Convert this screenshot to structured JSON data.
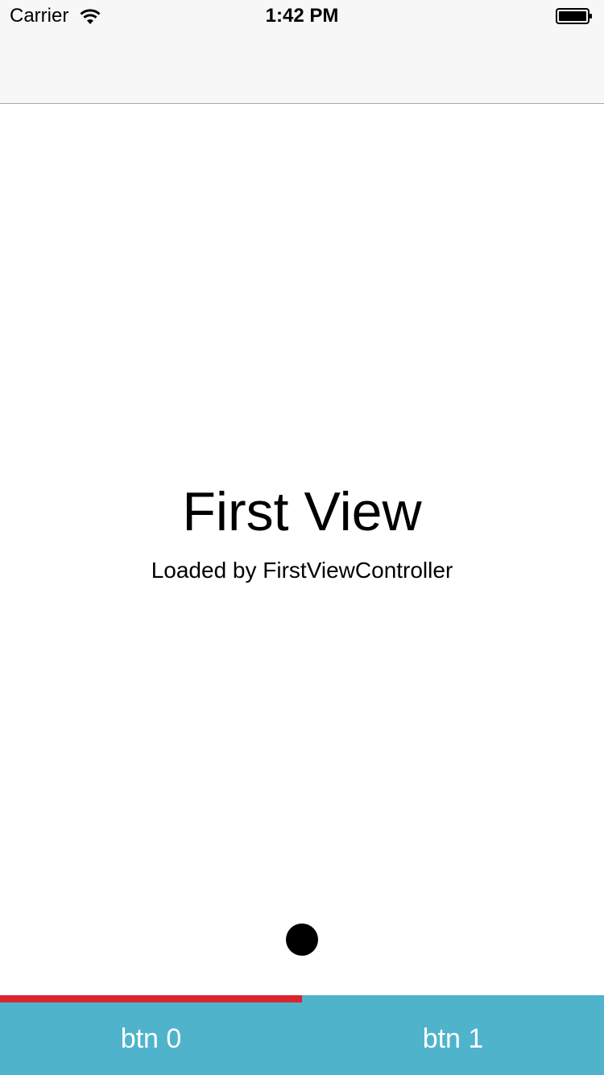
{
  "status_bar": {
    "carrier": "Carrier",
    "time": "1:42 PM",
    "wifi_icon": "wifi-icon",
    "battery_icon": "battery-icon"
  },
  "content": {
    "title": "First View",
    "subtitle": "Loaded by FirstViewController"
  },
  "tab_bar": {
    "selected_index": 0,
    "buttons": [
      {
        "label": "btn 0"
      },
      {
        "label": "btn 1"
      }
    ]
  },
  "colors": {
    "tab_bar_background": "#4fb3cc",
    "indicator": "#d9252e",
    "nav_bar_background": "#f7f7f7"
  }
}
